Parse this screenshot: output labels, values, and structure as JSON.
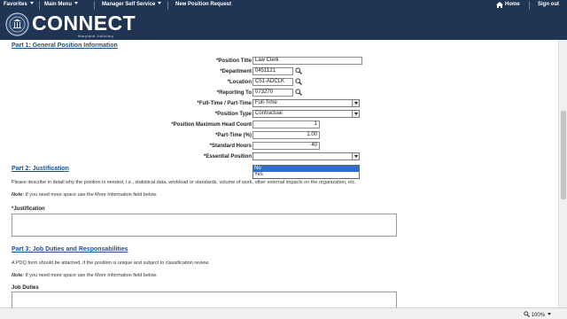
{
  "topnav": {
    "favorites": "Favorites",
    "main_menu": "Main Menu",
    "manager_self_service": "Manager Self Service",
    "current_page": "New Position Request",
    "home": "Home",
    "sign_out": "Sign out"
  },
  "brand": {
    "name": "CONNECT",
    "sub": "Maryland Judiciary"
  },
  "part1": {
    "title": "Part 1: General Position Information",
    "fields": {
      "position_title": {
        "label": "*Position Title",
        "value": "Law Clerk"
      },
      "department": {
        "label": "*Department",
        "value": "0451121"
      },
      "location": {
        "label": "*Location",
        "value": "C51-ADCLK"
      },
      "reporting_to": {
        "label": "*Reporting To",
        "value": "073270"
      },
      "full_part_time": {
        "label": "*Full-Time / Part-Time",
        "value": "Full-Time"
      },
      "position_type": {
        "label": "*Position Type",
        "value": "Contractual"
      },
      "max_head_count": {
        "label": "*Position Maximum Head Count",
        "value": "1"
      },
      "part_time_pct": {
        "label": "*Part-Time (%)",
        "value": "1.00"
      },
      "standard_hours": {
        "label": "*Standard Hours",
        "value": "40"
      },
      "essential_position": {
        "label": "*Essential Position",
        "value": "",
        "options": [
          "No",
          "Yes"
        ]
      }
    }
  },
  "part2": {
    "title": "Part 2: Justification",
    "description": "Please describe in detail why the position is needed, i.e., statistical data, workload or standards, volume of work, other external impacts on the organization, etc.",
    "note_label": "Note:",
    "note_text": " If you need more space use the More Information field below.",
    "field_label": "*Justification"
  },
  "part3": {
    "title": "Part 3: Job Duties and Responsabilities",
    "description": "A PDQ form should be attached, if the position is unique and subject to classification review.",
    "note_label": "Note:",
    "note_text": " If you need more space use the More Information field below.",
    "field_label": "Job Duties"
  },
  "statusbar": {
    "zoom": "100%"
  }
}
